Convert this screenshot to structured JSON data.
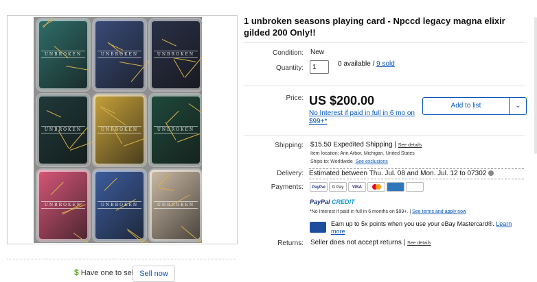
{
  "listing": {
    "title": "1 unbroken seasons playing card - Npccd legacy magna elixir gilded 200 Only!!",
    "condition_label": "Condition:",
    "condition_value": "New",
    "quantity_label": "Quantity:",
    "quantity_value": "1",
    "available_text": "0 available / ",
    "sold_link": "9 sold",
    "price_label": "Price:",
    "price_value": "US $200.00",
    "no_interest_text": "No Interest if paid in full in 6 mo on $99+*",
    "add_to_list_label": "Add to list",
    "shipping_label": "Shipping:",
    "shipping_cost": "$15.50",
    "shipping_method": "Expedited Shipping",
    "see_details_1": "See details",
    "item_location": "Item location:  Ann Arbor, Michigan, United States",
    "ships_to": "Ships to:  Worldwide",
    "see_exclusions": "See exclusions",
    "delivery_label": "Delivery:",
    "delivery_text": "Estimated between Thu. Jul. 08 and Mon. Jul. 12 to 07302",
    "payments_label": "Payments:",
    "payment_icons": [
      "PayPal",
      "G Pay",
      "VISA",
      "MC",
      "AMEX",
      "DISCOVER"
    ],
    "paypal_credit_a": "PayPal",
    "paypal_credit_b": "CREDIT",
    "paypal_fine_print": "*No Interest if paid in full in 6 months on $99+.",
    "see_terms": "See terms and apply now",
    "mastercard_text": "Earn up to 5x points when you use your eBay Mastercard®.",
    "learn_more": "Learn more",
    "returns_label": "Returns:",
    "returns_text": "Seller does not accept returns",
    "see_details_2": "See details"
  },
  "sell": {
    "have_one": "Have one to sell?",
    "sell_now": "Sell now"
  },
  "card_brand": "UNBROKEN",
  "card_colors": [
    "#2f6e6a",
    "#3a4c7a",
    "#2a3148",
    "#1f3a3a",
    "#c9a33a",
    "#1f4a3c",
    "#d9577a",
    "#3d5ea0",
    "#cdbba6"
  ]
}
